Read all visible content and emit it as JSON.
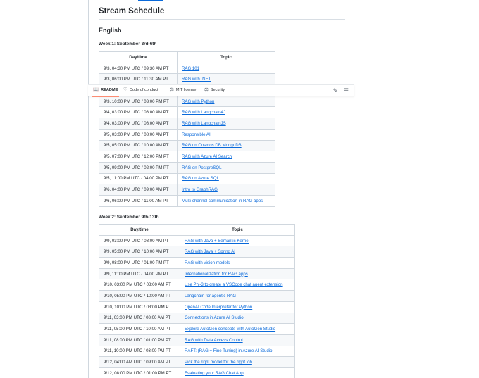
{
  "page_title": "Stream Schedule",
  "language_heading": "English",
  "tabs": {
    "readme": "README",
    "code_of_conduct": "Code of conduct",
    "mit_license": "MIT license",
    "security": "Security"
  },
  "week1": {
    "title": "Week 1: September 3rd-6th",
    "columns": [
      "Day/time",
      "Topic"
    ],
    "rows": [
      {
        "time": "9/3, 04:30 PM UTC / 09:30 AM PT",
        "topic": "RAG 101"
      },
      {
        "time": "9/3, 06:00 PM UTC / 11:30 AM PT",
        "topic": "RAG with .NET"
      },
      {
        "time": "",
        "topic": ""
      },
      {
        "time": "9/3, 10:00 PM UTC / 03:00 PM PT",
        "topic": "RAG with Python"
      },
      {
        "time": "9/4, 03:00 PM UTC / 08:00 AM PT",
        "topic": "RAG with Langchain4J"
      },
      {
        "time": "9/4, 03:00 PM UTC / 08:00 AM PT",
        "topic": "RAG with LangchainJS"
      },
      {
        "time": "9/5, 03:00 PM UTC / 08:00 AM PT",
        "topic": "Responsible AI"
      },
      {
        "time": "9/5, 05:00 PM UTC / 10:00 AM PT",
        "topic": "RAG on Cosmos DB MongoDB"
      },
      {
        "time": "9/5, 07:00 PM UTC / 12:00 PM PT",
        "topic": "RAG with Azure AI Search"
      },
      {
        "time": "9/5, 09:00 PM UTC / 02:00 PM PT",
        "topic": "RAG on PostgreSQL"
      },
      {
        "time": "9/5, 11:00 PM UTC / 04:00 PM PT",
        "topic": "RAG on Azure SQL"
      },
      {
        "time": "9/6, 04:00 PM UTC / 09:00 AM PT",
        "topic": "Intro to GraphRAG"
      },
      {
        "time": "9/6, 06:00 PM UTC / 11:00 AM PT",
        "topic": "Multi-channel communication in RAG apps"
      }
    ]
  },
  "week2": {
    "title": "Week 2: September 9th-13th",
    "columns": [
      "Day/time",
      "Topic"
    ],
    "rows": [
      {
        "time": "9/9, 03:00 PM UTC / 08:00 AM PT",
        "topic": "RAG with Java + Semantic Kernel"
      },
      {
        "time": "9/9, 05:00 PM UTC / 10:00 AM PT",
        "topic": "RAG with Java + Spring AI"
      },
      {
        "time": "9/9, 08:00 PM UTC / 01:00 PM PT",
        "topic": "RAG with vision models"
      },
      {
        "time": "9/9, 11:00 PM UTC / 04:00 PM PT",
        "topic": "Internationalization for RAG apps"
      },
      {
        "time": "9/10, 03:00 PM UTC / 08:00 AM PT",
        "topic": "Use Phi-3 to create a VSCode chat agent extension"
      },
      {
        "time": "9/10, 05:00 PM UTC / 10:00 AM PT",
        "topic": "Langchain for agentic RAG"
      },
      {
        "time": "9/10, 10:00 PM UTC / 03:00 PM PT",
        "topic": "OpenAI Code Interpreter for Python"
      },
      {
        "time": "9/11, 03:00 PM UTC / 08:00 AM PT",
        "topic": "Connections in Azure AI Studio"
      },
      {
        "time": "9/11, 05:00 PM UTC / 10:00 AM PT",
        "topic": "Explore AutoGen concepts with AutoGen Studio"
      },
      {
        "time": "9/11, 08:00 PM UTC / 01:00 PM PT",
        "topic": "RAG with Data Access Control"
      },
      {
        "time": "9/11, 10:00 PM UTC / 03:00 PM PT",
        "topic": "RAFT: (RAG + Fine Tuning) in Azure AI Studio"
      },
      {
        "time": "9/12, 04:00 AM UTC / 09:00 AM PT",
        "topic": "Pick the right model for the right job"
      },
      {
        "time": "9/12, 08:00 PM UTC / 01:00 PM PT",
        "topic": "Evaluating your RAG Chat App"
      }
    ]
  },
  "colors": {
    "link": "#0969da",
    "border": "#d0d7de",
    "active_tab_underline": "#fd8c73"
  },
  "icons": {
    "readme": "book-icon",
    "code_of_conduct": "heart-icon",
    "mit_license": "law-scale-icon",
    "security": "shield-icon",
    "edit": "pencil-icon",
    "toc": "list-icon"
  }
}
